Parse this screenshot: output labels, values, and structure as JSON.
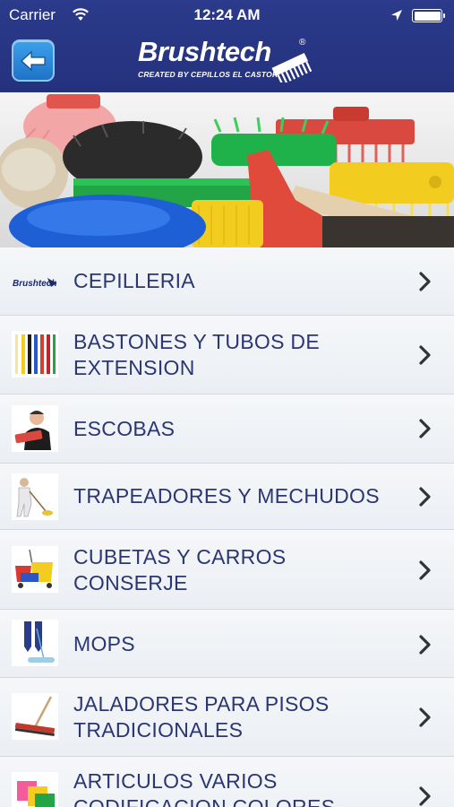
{
  "status_bar": {
    "carrier": "Carrier",
    "time": "12:24 AM"
  },
  "nav": {
    "logo_text": "Brushtech",
    "logo_registered": "®",
    "logo_tagline": "CREATED BY CEPILLOS EL CASTOR",
    "back_icon": "back-arrow-icon"
  },
  "thumb_logo_text": "Brushtech",
  "menu": {
    "items": [
      {
        "label_lines": [
          "CEPILLERIA"
        ],
        "icon": "brushtech-logo"
      },
      {
        "label_lines": [
          "BASTONES Y TUBOS DE",
          "EXTENSION"
        ],
        "icon": "colored-handles"
      },
      {
        "label_lines": [
          "ESCOBAS"
        ],
        "icon": "man-with-broom"
      },
      {
        "label_lines": [
          "TRAPEADORES Y MECHUDOS"
        ],
        "icon": "person-mopping"
      },
      {
        "label_lines": [
          "CUBETAS Y CARROS",
          "CONSERJE"
        ],
        "icon": "janitor-buckets"
      },
      {
        "label_lines": [
          "MOPS"
        ],
        "icon": "dust-mop"
      },
      {
        "label_lines": [
          "JALADORES PARA PISOS",
          "TRADICIONALES"
        ],
        "icon": "floor-squeegee"
      },
      {
        "label_lines": [
          "ARTICULOS VARIOS",
          "CODIFICACION COLORES"
        ],
        "icon": "color-cloths"
      }
    ]
  },
  "colors": {
    "nav_blue": "#2b3a8a",
    "label_navy": "#2b3672",
    "back_button_blue": "#2a86d9"
  }
}
